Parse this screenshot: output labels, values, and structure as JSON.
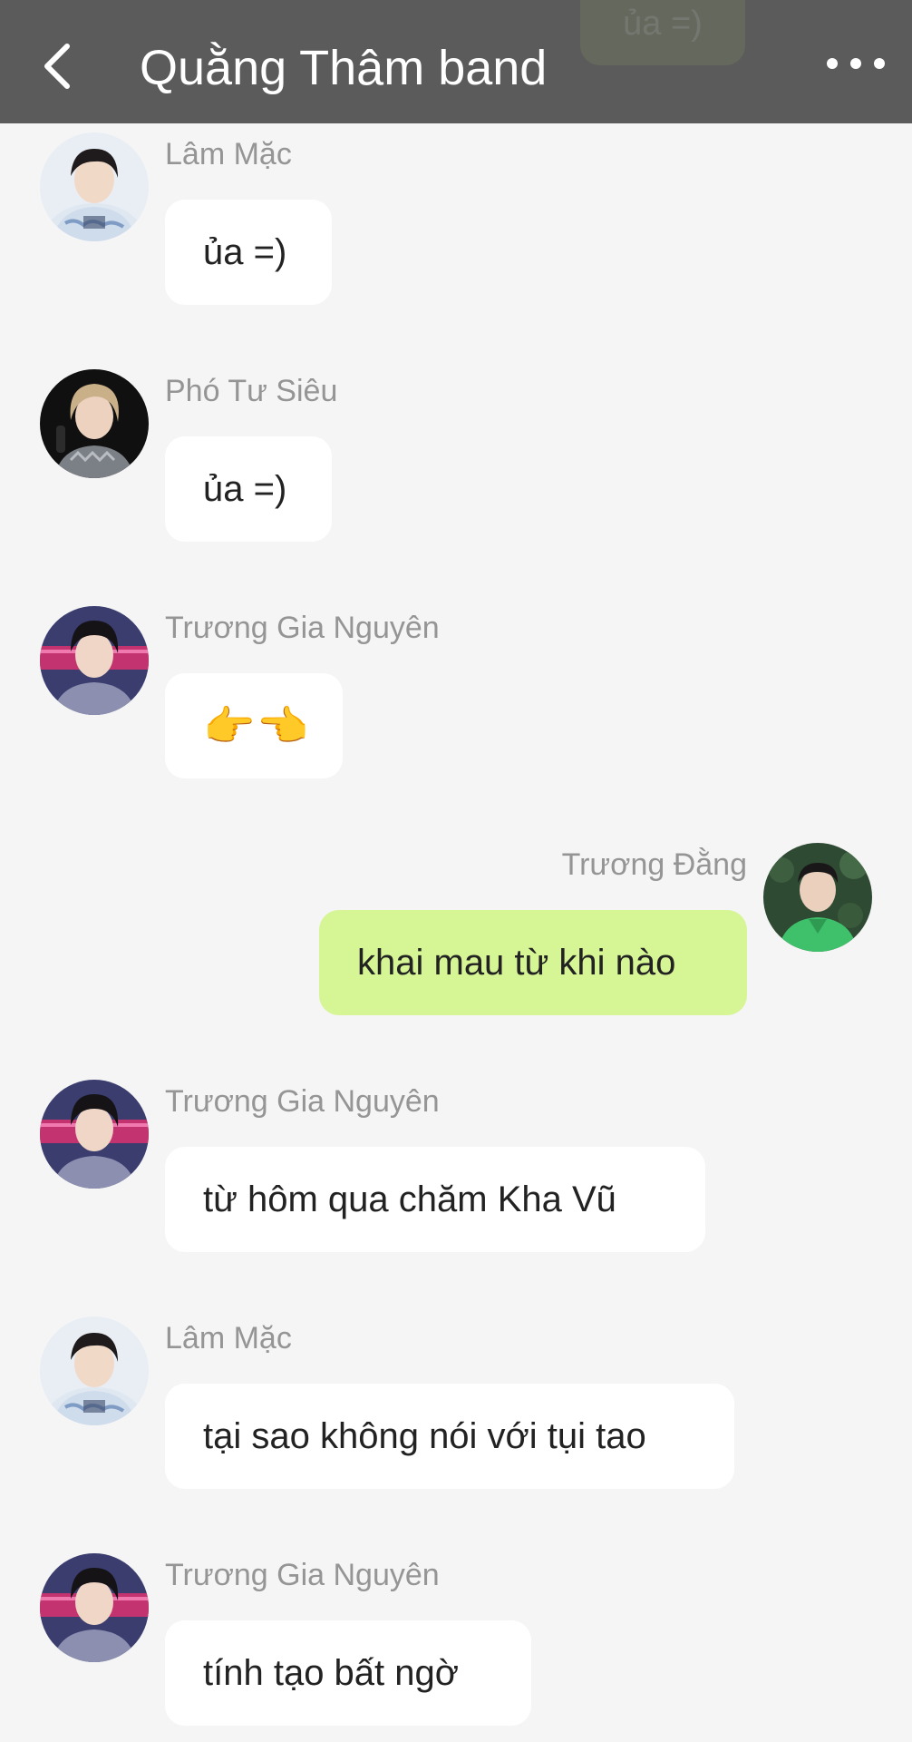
{
  "header": {
    "title": "Quằng Thâm band",
    "back_icon": "chevron-left-icon",
    "more_icon": "more-horizontal-icon",
    "ghost_text": "ủa =)"
  },
  "colors": {
    "header_bg": "#5b5b5b",
    "page_bg": "#f5f5f5",
    "incoming_bubble": "#ffffff",
    "outgoing_bubble": "#d6f595",
    "sender_name": "#959595"
  },
  "messages": [
    {
      "sender": "Lâm Mặc",
      "text": "ủa =)",
      "side": "left",
      "avatar": "avatar-lam-mac"
    },
    {
      "sender": "Phó Tư Siêu",
      "text": "ủa =)",
      "side": "left",
      "avatar": "avatar-pho-tu-sieu"
    },
    {
      "sender": "Trương Gia Nguyên",
      "text": "👉👈",
      "side": "left",
      "avatar": "avatar-truong-gia-nguyen"
    },
    {
      "sender": "Trương Đằng",
      "text": "khai mau từ khi nào",
      "side": "right",
      "avatar": "avatar-truong-dang"
    },
    {
      "sender": "Trương Gia Nguyên",
      "text": "từ hôm qua chăm Kha Vũ",
      "side": "left",
      "avatar": "avatar-truong-gia-nguyen"
    },
    {
      "sender": "Lâm Mặc",
      "text": "tại sao không nói với tụi tao",
      "side": "left",
      "avatar": "avatar-lam-mac"
    },
    {
      "sender": "Trương Gia Nguyên",
      "text": "tính tạo bất ngờ",
      "side": "left",
      "avatar": "avatar-truong-gia-nguyen"
    }
  ]
}
